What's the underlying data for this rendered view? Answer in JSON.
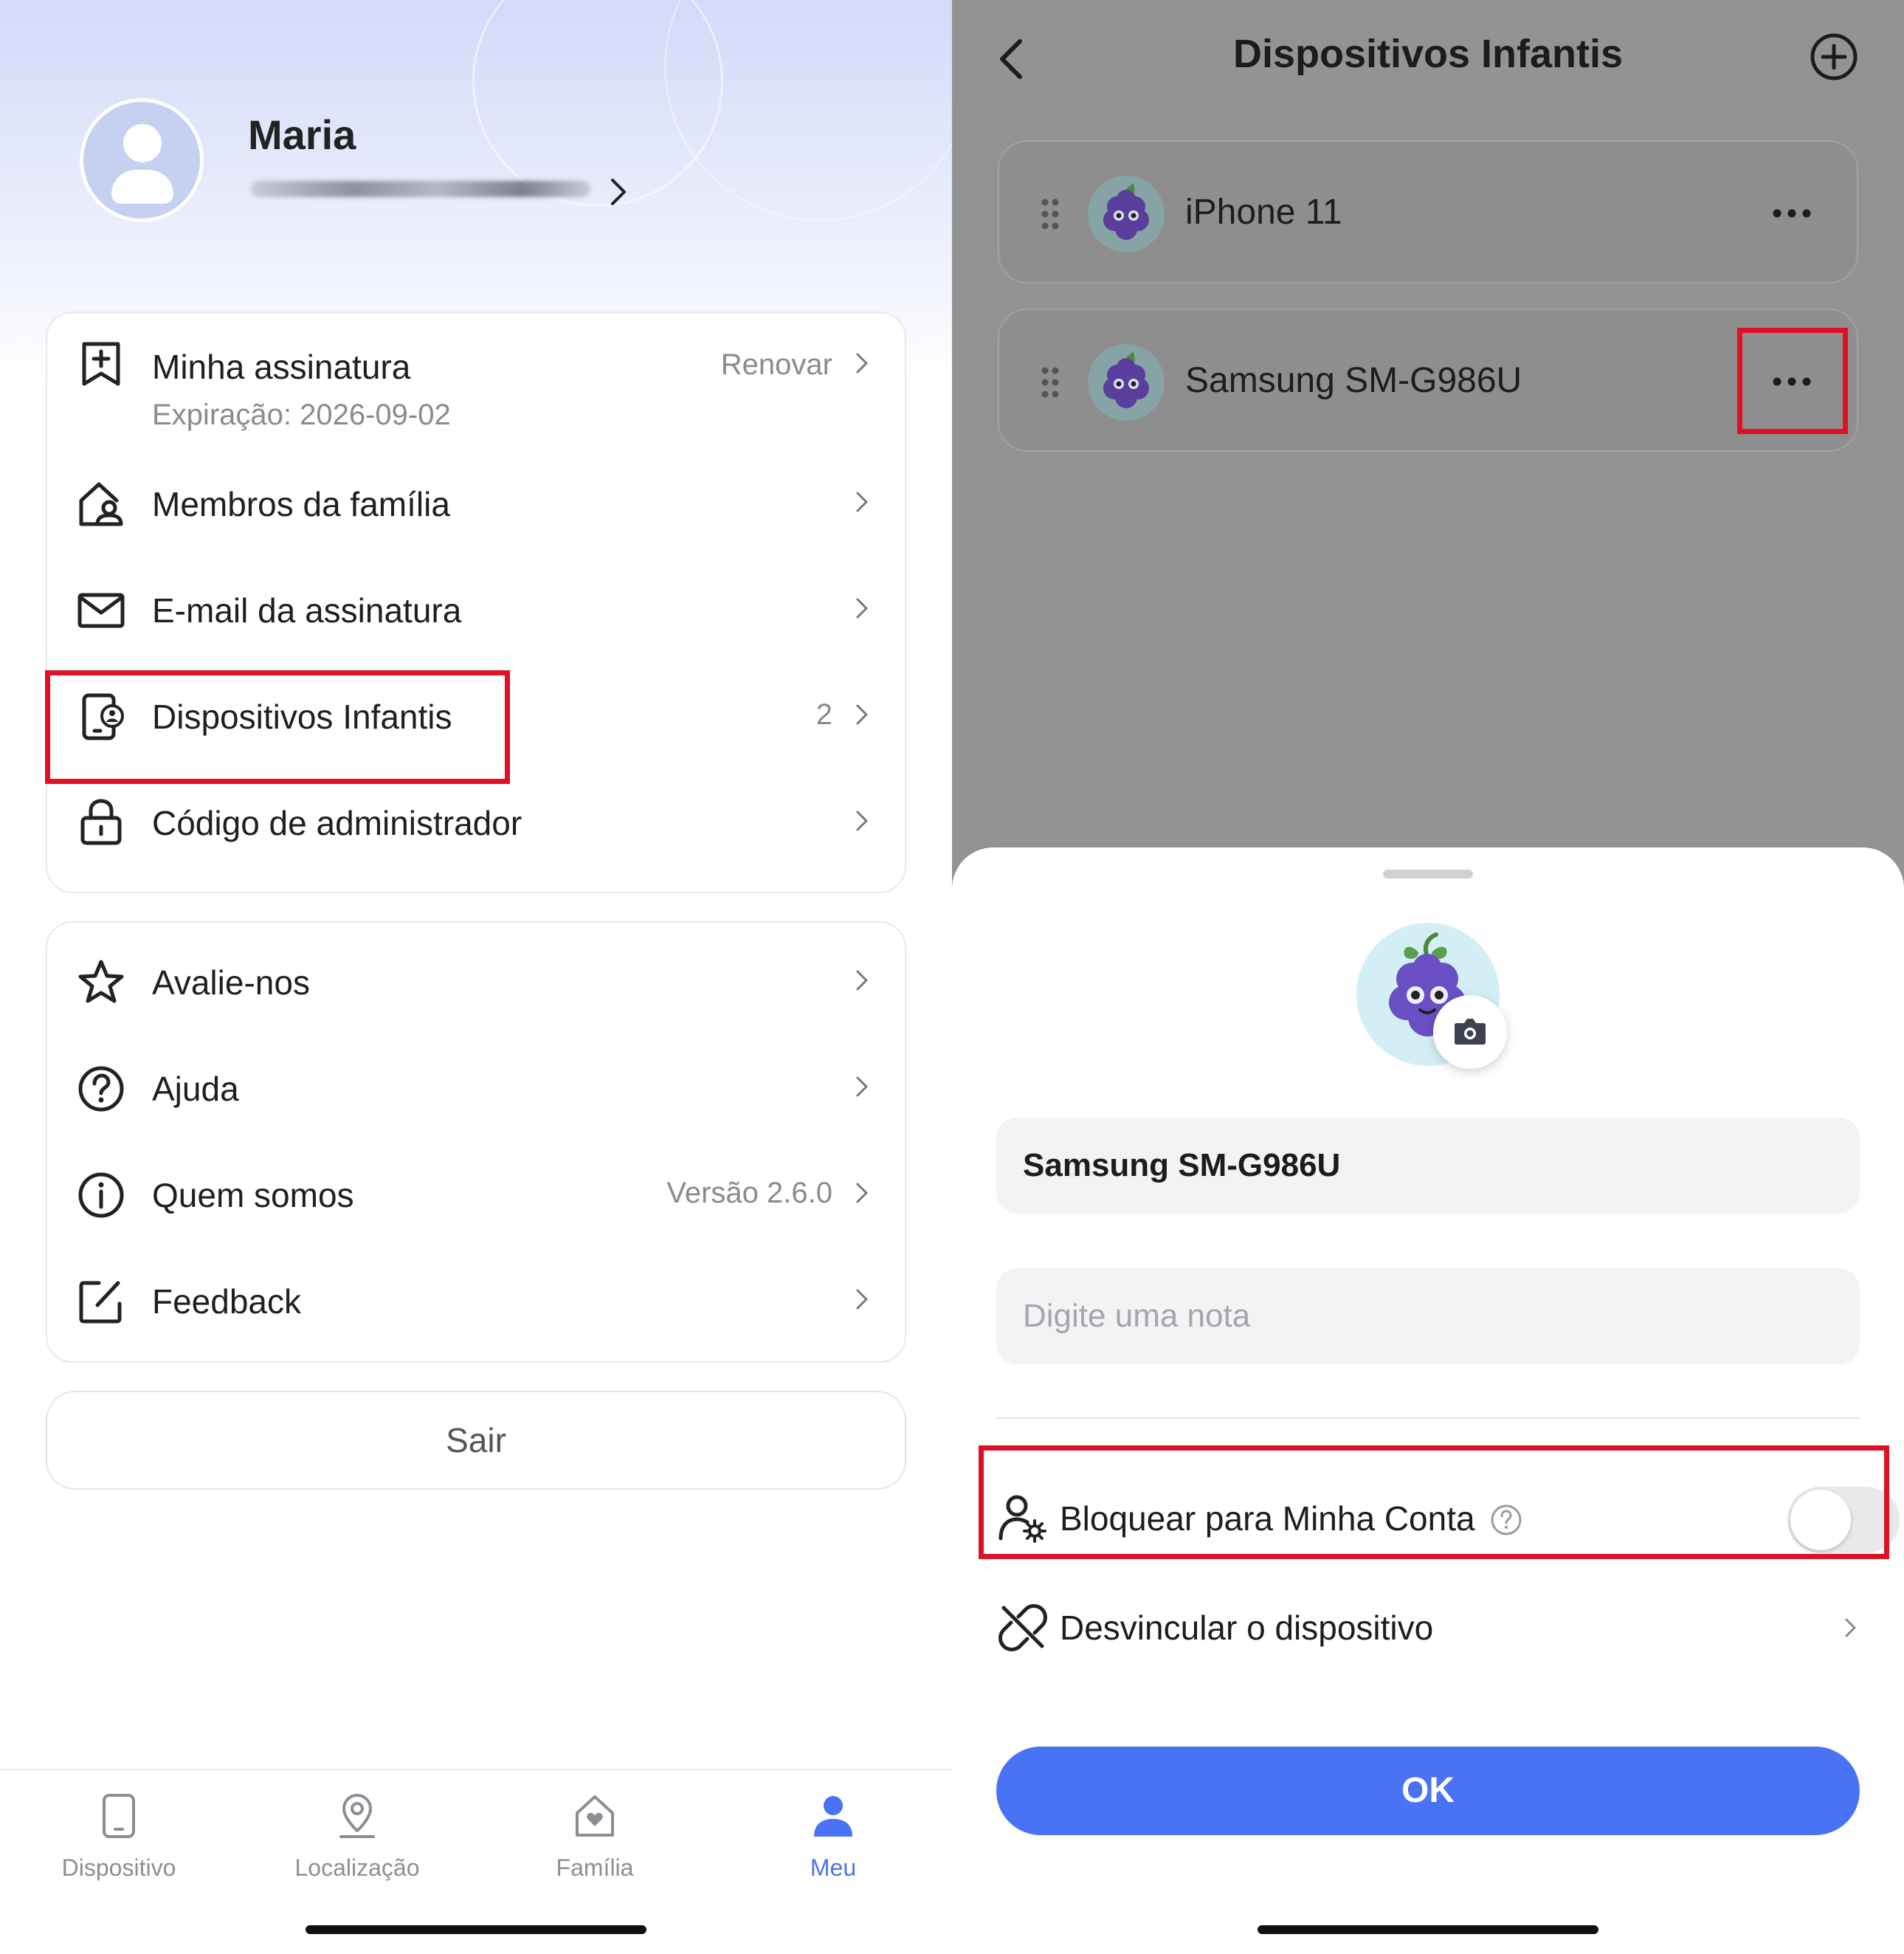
{
  "left": {
    "profile": {
      "name": "Maria"
    },
    "subscription": {
      "label": "Minha assinatura",
      "expiry": "Expiração: 2026-09-02",
      "action": "Renovar"
    },
    "menu1": [
      {
        "label": "Membros da família",
        "value": ""
      },
      {
        "label": "E-mail da assinatura",
        "value": ""
      },
      {
        "label": "Dispositivos Infantis",
        "value": "2"
      },
      {
        "label": "Código de administrador",
        "value": ""
      }
    ],
    "menu2": [
      {
        "label": "Avalie-nos",
        "value": ""
      },
      {
        "label": "Ajuda",
        "value": ""
      },
      {
        "label": "Quem somos",
        "value": "Versão 2.6.0"
      },
      {
        "label": "Feedback",
        "value": ""
      }
    ],
    "logout": "Sair",
    "tabs": [
      {
        "label": "Dispositivo",
        "icon": "phone-icon",
        "active": false
      },
      {
        "label": "Localização",
        "icon": "location-pin-icon",
        "active": false
      },
      {
        "label": "Família",
        "icon": "house-heart-icon",
        "active": false
      },
      {
        "label": "Meu",
        "icon": "person-icon",
        "active": true
      }
    ]
  },
  "right": {
    "title": "Dispositivos Infantis",
    "devices": [
      {
        "name": "iPhone 11"
      },
      {
        "name": "Samsung SM-G986U"
      }
    ],
    "sheet": {
      "device_name": "Samsung SM-G986U",
      "note_placeholder": "Digite uma nota",
      "lock_label": "Bloquear para Minha Conta",
      "lock_enabled": false,
      "unlink_label": "Desvincular o dispositivo",
      "ok_label": "OK"
    }
  },
  "colors": {
    "accent": "#4a72f4",
    "highlight": "#e01025",
    "tab_active": "#4a72f4",
    "tab_inactive": "#8d8d95"
  }
}
